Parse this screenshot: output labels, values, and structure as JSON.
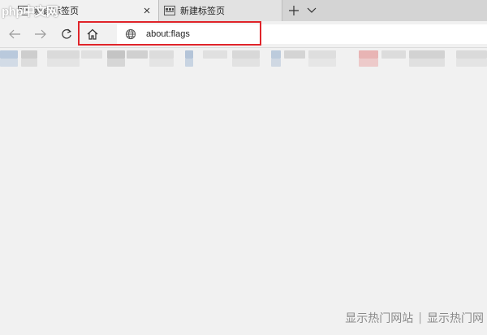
{
  "watermark": {
    "logo_text": "php中文网"
  },
  "tabs": [
    {
      "title": "新建标签页",
      "active": true
    },
    {
      "title": "新建标签页",
      "active": false
    }
  ],
  "icons": {
    "new_tab": "plus-icon",
    "tab_list": "chevron-down-icon",
    "back": "arrow-left-icon",
    "forward": "arrow-right-icon",
    "refresh": "refresh-icon",
    "home": "home-icon",
    "site_info": "globe-icon",
    "tab_close": "close-icon",
    "tab_favicon": "new-tab-page-icon"
  },
  "address_bar": {
    "value": "about:flags"
  },
  "colors": {
    "highlight": "#e0242a",
    "background": "#f1f1f1"
  },
  "footer": {
    "link_1": "显示热门网站",
    "separator": "|",
    "link_2": "显示热门网"
  }
}
